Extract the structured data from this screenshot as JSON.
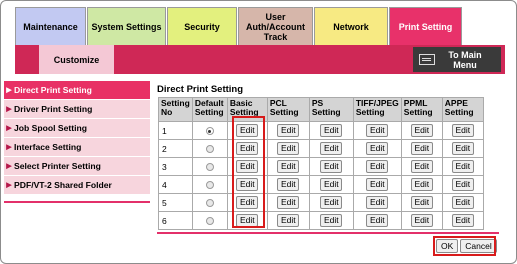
{
  "tabs": [
    {
      "label": "Maintenance"
    },
    {
      "label": "System Settings"
    },
    {
      "label": "Security"
    },
    {
      "label": "User Auth/Account Track"
    },
    {
      "label": "Network"
    },
    {
      "label": "Print Setting"
    }
  ],
  "subnav": {
    "customize": "Customize",
    "to_main_menu": "To Main Menu"
  },
  "menu": [
    {
      "label": "Direct Print Setting"
    },
    {
      "label": "Driver Print Setting"
    },
    {
      "label": "Job Spool Setting"
    },
    {
      "label": "Interface Setting"
    },
    {
      "label": "Select Printer Setting"
    },
    {
      "label": "PDF/VT-2 Shared Folder"
    }
  ],
  "main": {
    "title": "Direct Print Setting",
    "columns": [
      "Setting No",
      "Default Setting",
      "Basic Setting",
      "PCL Setting",
      "PS Setting",
      "TIFF/JPEG Setting",
      "PPML Setting",
      "APPE Setting"
    ],
    "rows": [
      {
        "no": "1",
        "default": true
      },
      {
        "no": "2",
        "default": false
      },
      {
        "no": "3",
        "default": false
      },
      {
        "no": "4",
        "default": false
      },
      {
        "no": "5",
        "default": false
      },
      {
        "no": "6",
        "default": false
      }
    ],
    "edit_label": "Edit"
  },
  "footer": {
    "ok": "OK",
    "cancel": "Cancel"
  },
  "colors": {
    "accent": "#e83165",
    "highlight": "#d81b1b"
  }
}
